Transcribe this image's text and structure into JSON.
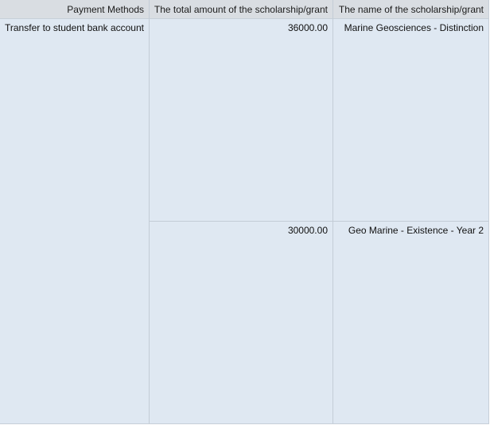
{
  "table": {
    "columns": [
      "Payment Methods",
      "The total amount of the scholarship/grant",
      "The name of the scholarship/grant"
    ],
    "payment_method": "Transfer to student bank account",
    "rows": [
      {
        "amount": "36000.00",
        "name": "Marine Geosciences - Distinction"
      },
      {
        "amount": "30000.00",
        "name": "Geo Marine - Existence - Year 2"
      }
    ]
  }
}
